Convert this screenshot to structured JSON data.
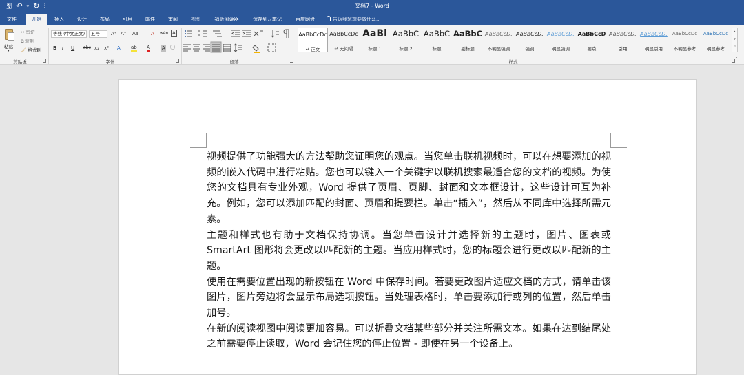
{
  "window": {
    "title": "文档7 - Word"
  },
  "qat": {
    "save_glyph": "🖫",
    "undo_glyph": "↶",
    "undo_arrow": "▾",
    "redo_glyph": "↻",
    "customize_glyph": "⫶"
  },
  "tabs": [
    {
      "label": "文件"
    },
    {
      "label": "开始"
    },
    {
      "label": "插入"
    },
    {
      "label": "设计"
    },
    {
      "label": "布局"
    },
    {
      "label": "引用"
    },
    {
      "label": "邮件"
    },
    {
      "label": "审阅"
    },
    {
      "label": "视图"
    },
    {
      "label": "福昕阅读器"
    },
    {
      "label": "保存到云笔记"
    },
    {
      "label": "百度网盘"
    }
  ],
  "tell_me": {
    "placeholder": "告诉我您想要做什么..."
  },
  "clipboard": {
    "paste_label": "粘贴",
    "cut_label": "剪切",
    "copy_label": "复制",
    "format_painter_label": "格式刷",
    "group_label": "剪贴板"
  },
  "font": {
    "font_name": "等线 (中文正文)",
    "font_size": "五号",
    "bold": "B",
    "italic": "I",
    "underline": "U",
    "strike": "abc",
    "subscript": "x₂",
    "superscript": "x²",
    "grow": "A⁺",
    "shrink": "A⁻",
    "case": "Aa",
    "clear": "A",
    "phonetic": "wén",
    "border_char": "A",
    "effects": "A",
    "highlight": "ab",
    "font_color": "A",
    "shading": "A",
    "enclose": "㊀",
    "group_label": "字体"
  },
  "paragraph": {
    "group_label": "段落"
  },
  "styles": {
    "group_label": "样式",
    "items": [
      {
        "preview": "AaBbCcDc",
        "name": "↵ 正文"
      },
      {
        "preview": "AaBbCcDc",
        "name": "↵ 无间隔"
      },
      {
        "preview": "AaBl",
        "name": "标题 1"
      },
      {
        "preview": "AaBbC",
        "name": "标题 2"
      },
      {
        "preview": "AaBbC",
        "name": "标题"
      },
      {
        "preview": "AaBbC",
        "name": "副标题"
      },
      {
        "preview": "AaBbCcD.",
        "name": "不明显强调"
      },
      {
        "preview": "AaBbCcD.",
        "name": "强调"
      },
      {
        "preview": "AaBbCcD.",
        "name": "明显强调"
      },
      {
        "preview": "AaBbCcD",
        "name": "要点"
      },
      {
        "preview": "AaBbCcD.",
        "name": "引用"
      },
      {
        "preview": "AaBbCcD.",
        "name": "明显引用"
      },
      {
        "preview": "AaBbCcDc",
        "name": "不明显参考"
      },
      {
        "preview": "AaBbCcDc",
        "name": "明显参考"
      }
    ]
  },
  "document": {
    "paragraphs": [
      "视频提供了功能强大的方法帮助您证明您的观点。当您单击联机视频时，可以在想要添加的视频的嵌入代码中进行粘贴。您也可以键入一个关键字以联机搜索最适合您的文档的视频。为使您的文档具有专业外观，Word 提供了页眉、页脚、封面和文本框设计，这些设计可互为补充。例如，您可以添加匹配的封面、页眉和提要栏。单击“插入”，然后从不同库中选择所需元素。",
      "主题和样式也有助于文档保持协调。当您单击设计并选择新的主题时，图片、图表或 SmartArt 图形将会更改以匹配新的主题。当应用样式时，您的标题会进行更改以匹配新的主题。",
      "使用在需要位置出现的新按钮在 Word 中保存时间。若要更改图片适应文档的方式，请单击该图片，图片旁边将会显示布局选项按钮。当处理表格时，单击要添加行或列的位置，然后单击加号。",
      "在新的阅读视图中阅读更加容易。可以折叠文档某些部分并关注所需文本。如果在达到结尾处之前需要停止读取，Word 会记住您的停止位置 - 即使在另一个设备上。"
    ]
  }
}
